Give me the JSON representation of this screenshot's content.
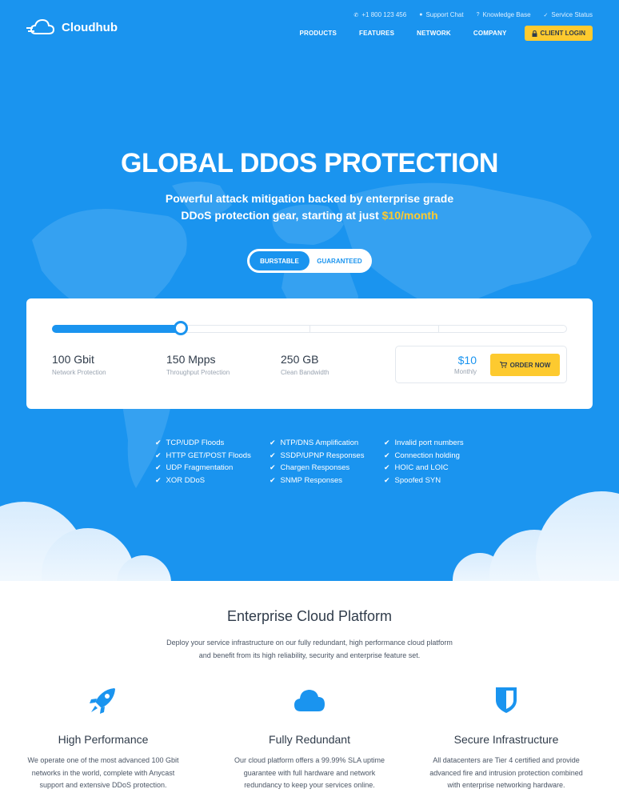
{
  "topbar": [
    {
      "icon": "phone-icon",
      "glyph": "✆",
      "label": "+1 800 123 456"
    },
    {
      "icon": "chat-icon",
      "glyph": "●",
      "label": "Support Chat"
    },
    {
      "icon": "help-icon",
      "glyph": "?",
      "label": "Knowledge Base"
    },
    {
      "icon": "check-icon",
      "glyph": "✓",
      "label": "Service Status"
    }
  ],
  "brand": {
    "name": "Cloudhub"
  },
  "nav": {
    "items": [
      "PRODUCTS",
      "FEATURES",
      "NETWORK",
      "COMPANY"
    ],
    "login_label": "CLIENT LOGIN"
  },
  "hero": {
    "title": "GLOBAL DDOS PROTECTION",
    "subtitle_line1": "Powerful attack mitigation backed by enterprise grade",
    "subtitle_line2": "DDoS protection gear, starting at just ",
    "subtitle_price": "$10/month"
  },
  "plan_toggle": {
    "options": [
      "BURSTABLE",
      "GUARANTEED"
    ],
    "selected": "BURSTABLE"
  },
  "pricing": {
    "slider_level": 0.25,
    "stats": [
      {
        "value": "100 Gbit",
        "label": "Network Protection"
      },
      {
        "value": "150 Mpps",
        "label": "Throughput Protection"
      },
      {
        "value": "250 GB",
        "label": "Clean Bandwidth"
      }
    ],
    "price": "$10",
    "period": "Monthly",
    "order_label": "ORDER NOW"
  },
  "features": [
    [
      "TCP/UDP Floods",
      "HTTP GET/POST Floods",
      "UDP Fragmentation",
      "XOR DDoS"
    ],
    [
      "NTP/DNS Amplification",
      "SSDP/UPNP Responses",
      "Chargen Responses",
      "SNMP Responses"
    ],
    [
      "Invalid port numbers",
      "Connection holding",
      "HOIC and LOIC",
      "Spoofed SYN"
    ]
  ],
  "platform": {
    "title": "Enterprise Cloud Platform",
    "desc_line1": "Deploy your service infrastructure on our fully redundant, high performance cloud platform",
    "desc_line2": "and benefit from its high reliability, security and enterprise feature set.",
    "columns": [
      {
        "icon": "rocket-icon",
        "title": "High Performance",
        "lines": [
          "We operate one of the most advanced 100 Gbit",
          "networks in the world, complete with Anycast",
          "support and extensive DDoS protection."
        ]
      },
      {
        "icon": "cloud-icon",
        "title": "Fully Redundant",
        "lines": [
          "Our cloud platform offers a 99.99% SLA uptime",
          "guarantee with full hardware and network",
          "redundancy to keep your services online."
        ]
      },
      {
        "icon": "shield-icon",
        "title": "Secure Infrastructure",
        "lines": [
          "All datacenters are Tier 4 certified and provide",
          "advanced fire and intrusion protection combined",
          "with enterprise networking hardware."
        ]
      }
    ]
  },
  "colors": {
    "primary": "#1a94ef",
    "accent": "#fdca2f",
    "text": "#2f3b4a"
  }
}
